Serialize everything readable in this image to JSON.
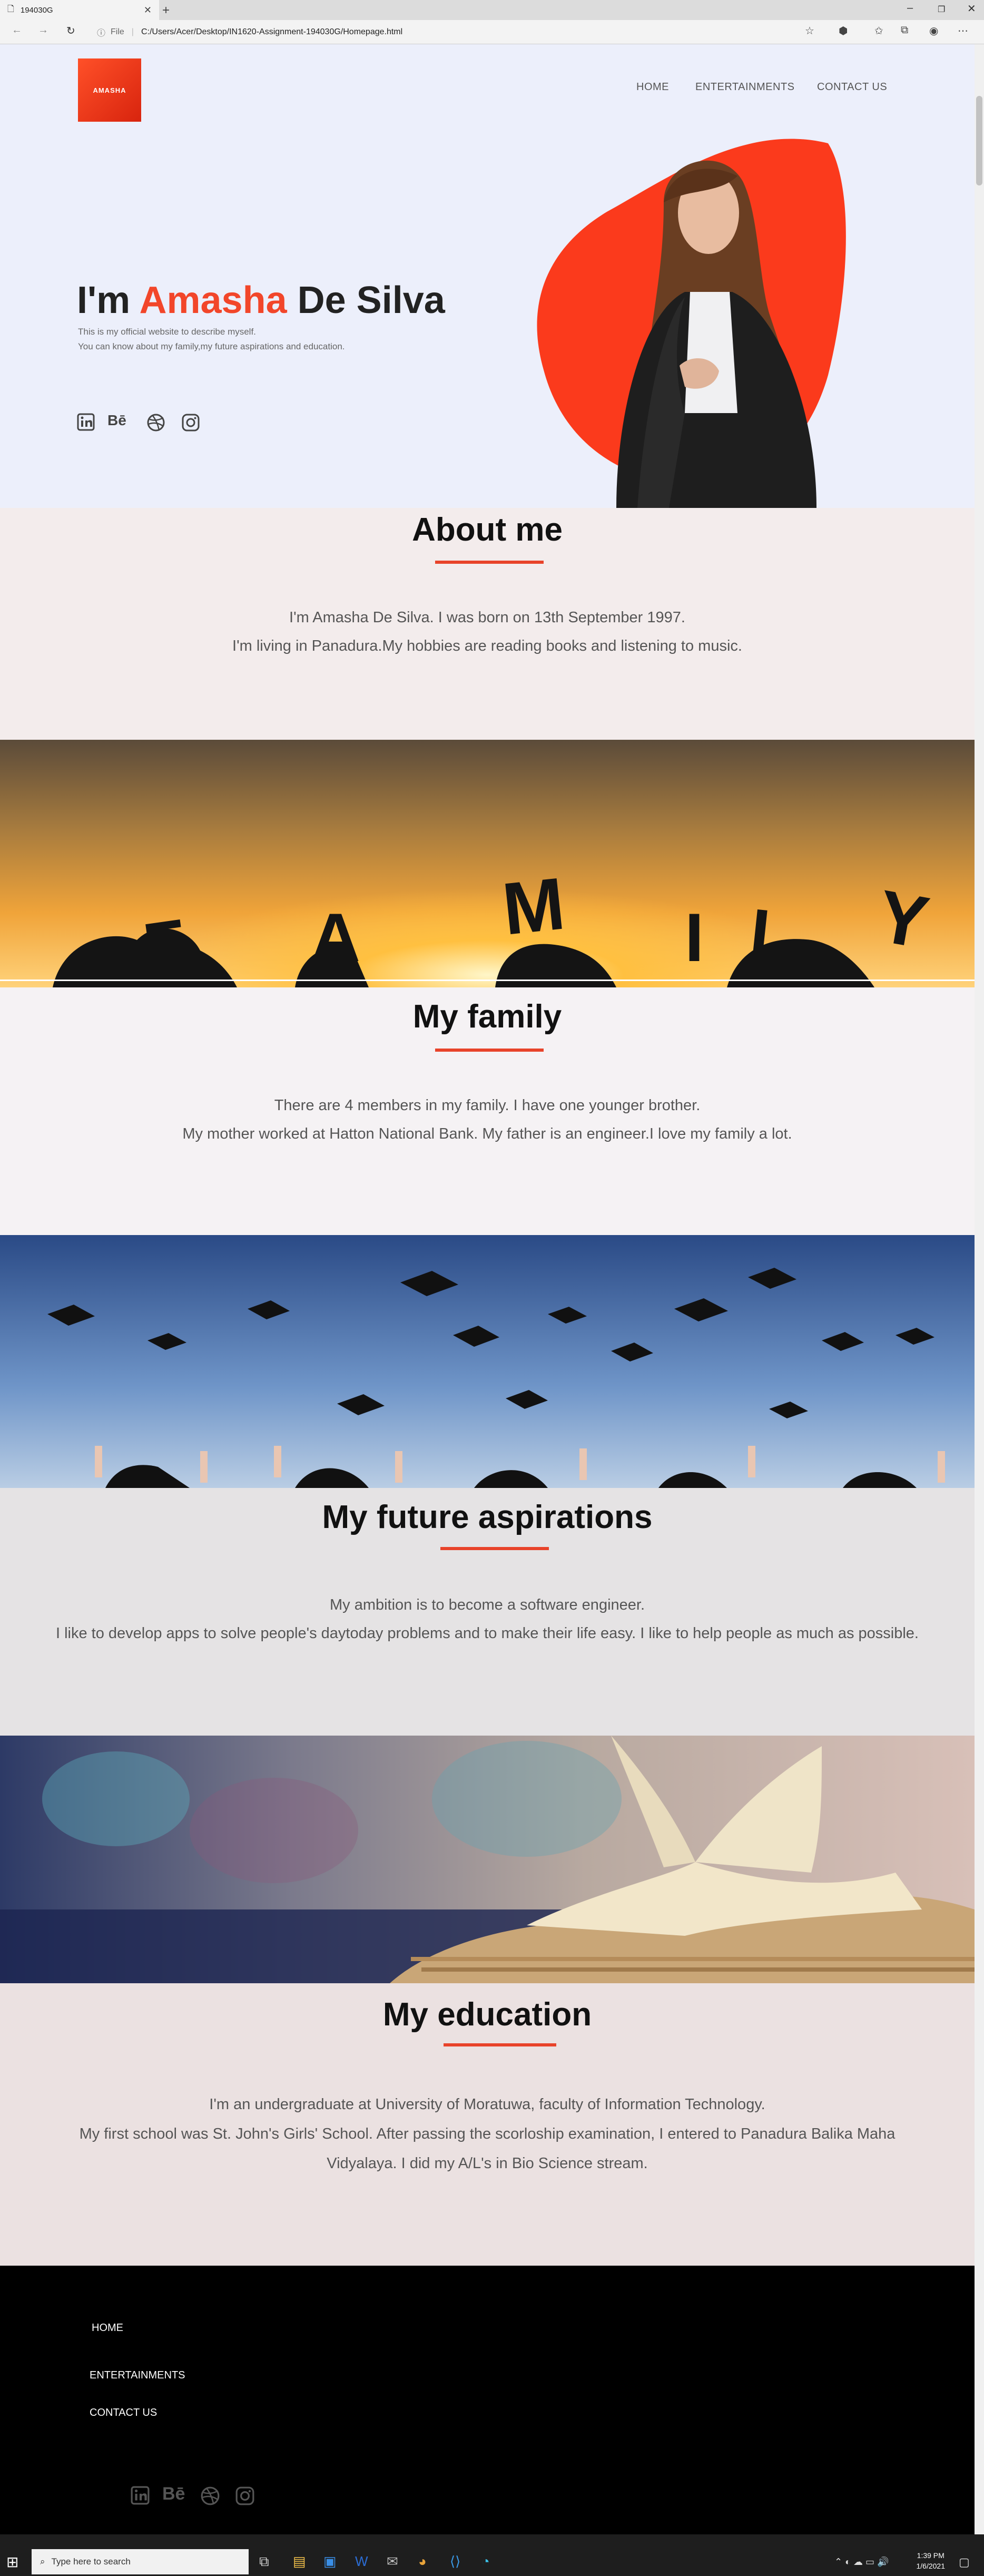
{
  "browser": {
    "tab_title": "194030G",
    "file_label": "File",
    "url": "C:/Users/Acer/Desktop/IN1620-Assignment-194030G/Homepage.html"
  },
  "site": {
    "logo_text": "AMASHA",
    "nav": [
      "HOME",
      "ENTERTAINMENTS",
      "CONTACT US"
    ],
    "hero": {
      "title_prefix": "I'm",
      "title_accent": "Amasha",
      "title_suffix": "De Silva",
      "subtitle_1": "This is my official website to describe myself.",
      "subtitle_2": "You can know about my family,my future aspirations and education."
    },
    "social_icons": [
      "linkedin-icon",
      "behance-icon",
      "dribbble-icon",
      "instagram-icon"
    ],
    "sections": [
      {
        "title": "About me",
        "lines": [
          "I'm Amasha De Silva. I was born on 13th September 1997.",
          "I'm living in Panadura.My hobbies are reading books and listening to music."
        ]
      },
      {
        "title": "My family",
        "lines": [
          "There are 4 members in my family. I have one younger brother.",
          "My mother worked at Hatton National Bank. My father is an engineer.I love my family a lot."
        ]
      },
      {
        "title": "My future aspirations",
        "lines": [
          "My ambition is to become a software engineer.",
          "I like to develop apps to solve people's daytoday problems and to make their life easy. I like to help people as much as possible."
        ]
      },
      {
        "title": "My education",
        "lines": [
          "I'm an undergraduate at University of Moratuwa, faculty of Information Technology.",
          "My first school was St. John's Girls' School. After passing the scorloship examination, I entered to Panadura Balika Maha",
          "Vidyalaya. I did my A/L's in Bio Science stream."
        ]
      }
    ],
    "banner_text": "FAMILY",
    "footer_links": [
      "HOME",
      "ENTERTAINMENTS",
      "CONTACT US"
    ]
  },
  "taskbar": {
    "search_placeholder": "Type here to search",
    "time": "1:39 PM",
    "date": "1/6/2021"
  },
  "colors": {
    "accent": "#f2462a",
    "hero_bg": "#eceffb",
    "footer_bg": "#000000"
  }
}
